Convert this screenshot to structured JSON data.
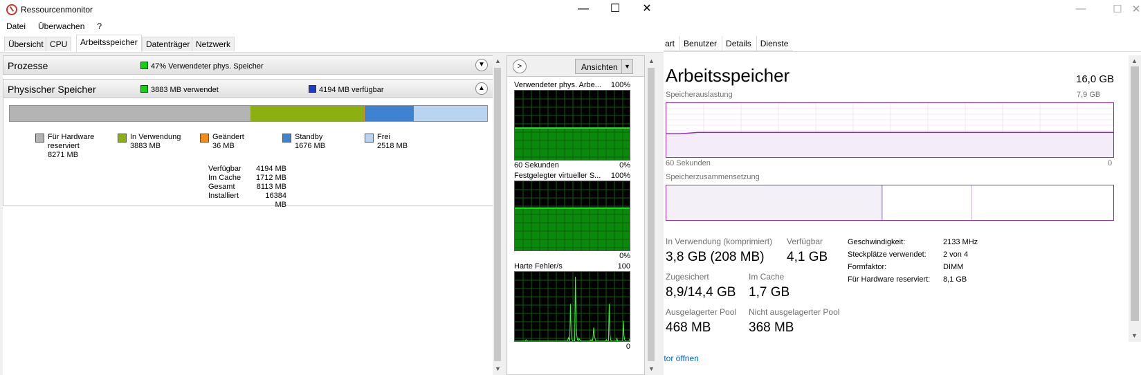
{
  "task_manager": {
    "tabs": [
      "art",
      "Benutzer",
      "Details",
      "Dienste"
    ],
    "heading": "Arbeitsspeicher",
    "total": "16,0 GB",
    "usage_label": "Speicherauslastung",
    "usage_max": "7,9 GB",
    "time_label": "60 Sekunden",
    "time_zero": "0",
    "composition_label": "Speicherzusammensetzung",
    "stats": {
      "in_use_label": "In Verwendung (komprimiert)",
      "in_use_value": "3,8 GB (208 MB)",
      "available_label": "Verfügbar",
      "available_value": "4,1 GB",
      "committed_label": "Zugesichert",
      "committed_value": "8,9/14,4 GB",
      "cached_label": "Im Cache",
      "cached_value": "1,7 GB",
      "paged_label": "Ausgelagerter Pool",
      "paged_value": "468 MB",
      "nonpaged_label": "Nicht ausgelagerter Pool",
      "nonpaged_value": "368 MB"
    },
    "details": {
      "speed_label": "Geschwindigkeit:",
      "speed_value": "2133 MHz",
      "slots_label": "Steckplätze verwendet:",
      "slots_value": "2 von 4",
      "form_label": "Formfaktor:",
      "form_value": "DIMM",
      "reserved_label": "Für Hardware reserviert:",
      "reserved_value": "8,1 GB"
    },
    "link": "nitor öffnen",
    "usage_fraction": 0.47
  },
  "resource_monitor": {
    "title": "Ressourcenmonitor",
    "menu": [
      "Datei",
      "Überwachen",
      "?"
    ],
    "tabs": [
      "Übersicht",
      "CPU",
      "Arbeitsspeicher",
      "Datenträger",
      "Netzwerk"
    ],
    "active_tab": "Arbeitsspeicher",
    "processes": {
      "title": "Prozesse",
      "indicator": "47% Verwendeter phys. Speicher"
    },
    "physical": {
      "title": "Physischer Speicher",
      "used": "3883 MB verwendet",
      "available": "4194 MB verfügbar",
      "segments_mb": [
        8271,
        3883,
        36,
        1676,
        2518
      ],
      "legend": [
        {
          "name": "Für Hardware",
          "name2": "reserviert",
          "value": "8271 MB",
          "color": "#b4b4b4"
        },
        {
          "name": "In Verwendung",
          "name2": "",
          "value": "3883 MB",
          "color": "#8cb010"
        },
        {
          "name": "Geändert",
          "name2": "",
          "value": "36 MB",
          "color": "#f08c18"
        },
        {
          "name": "Standby",
          "name2": "",
          "value": "1676 MB",
          "color": "#3f82d2"
        },
        {
          "name": "Frei",
          "name2": "",
          "value": "2518 MB",
          "color": "#b8d4f0"
        }
      ],
      "stats": [
        {
          "k": "Verfügbar",
          "v": "4194 MB"
        },
        {
          "k": "Im Cache",
          "v": "1712 MB"
        },
        {
          "k": "Gesamt",
          "v": "8113 MB"
        },
        {
          "k": "Installiert",
          "v": "16384 MB"
        }
      ]
    },
    "side": {
      "view_label": "Ansichten",
      "graph1_title": "Verwendeter phys. Arbe...",
      "graph1_max": "100%",
      "graph1_time": "60 Sekunden",
      "graph1_min": "0%",
      "graph2_title": "Festgelegter virtueller S...",
      "graph2_max": "100%",
      "graph2_min": "0%",
      "graph3_title": "Harte Fehler/s",
      "graph3_max": "100",
      "graph3_min": "0",
      "graph1_level": 0.47,
      "graph2_level": 0.62
    }
  }
}
